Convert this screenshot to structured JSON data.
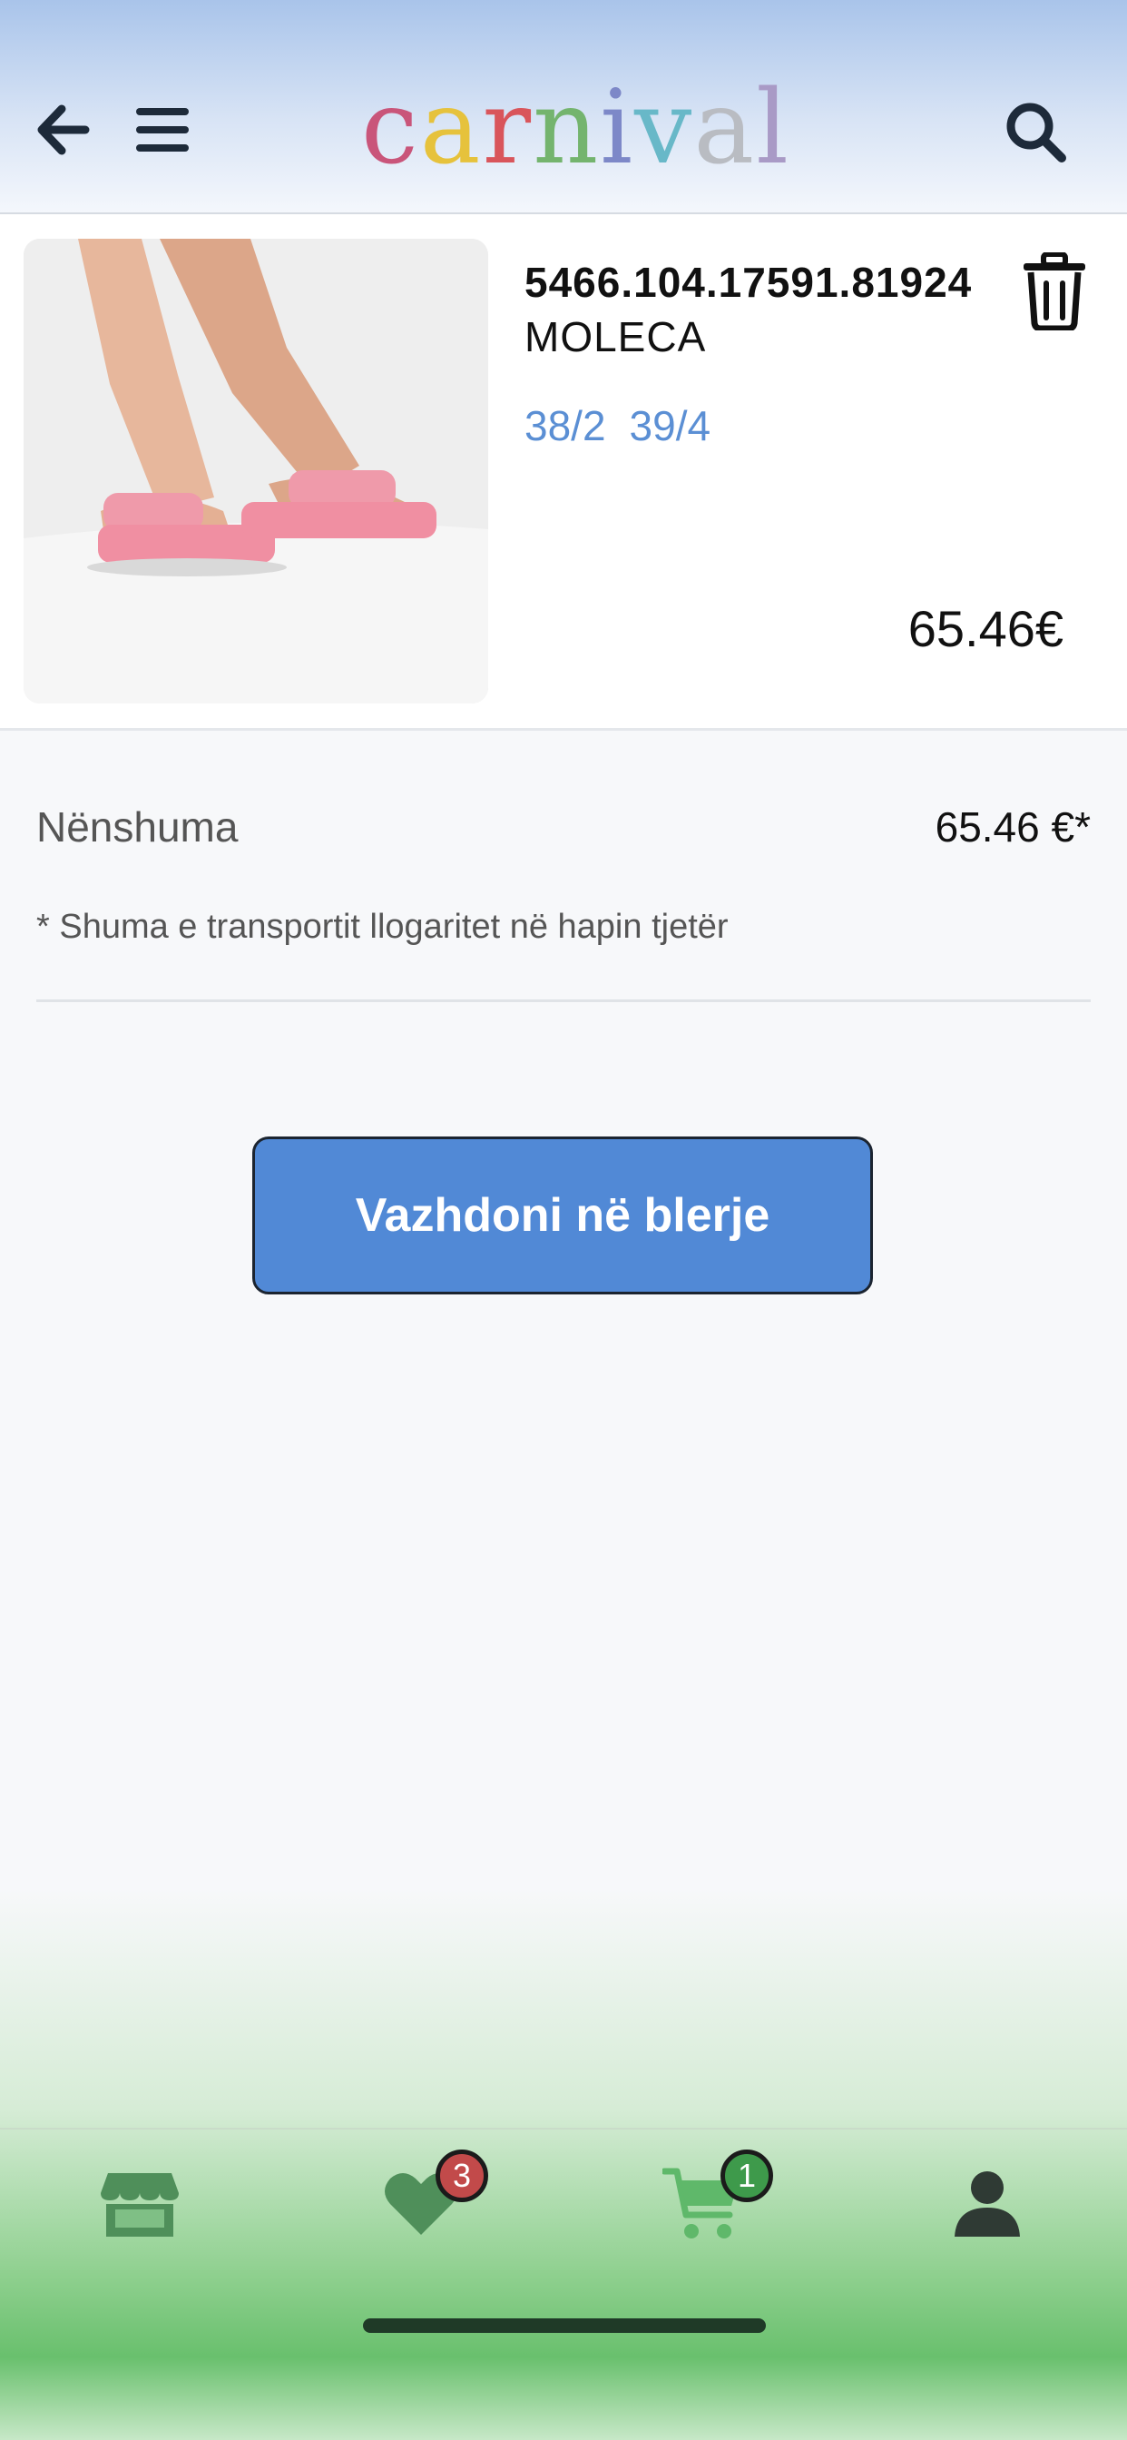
{
  "header": {
    "logo_letters": [
      "c",
      "a",
      "r",
      "n",
      "i",
      "v",
      "a",
      "l"
    ],
    "logo_colors": [
      "#c9557a",
      "#e6c23c",
      "#d9555b",
      "#74b46e",
      "#7d88c8",
      "#68b8c8",
      "#b9bcc2",
      "#a99ac6"
    ]
  },
  "cart": {
    "item": {
      "sku": "5466.104.17591.81924",
      "name": "MOLECA",
      "sizes": [
        "38/2",
        "39/4"
      ],
      "price": "65.46€"
    }
  },
  "summary": {
    "subtotal_label": "Nënshuma",
    "subtotal_value": "65.46 €*",
    "note": "* Shuma e transportit llogaritet në hapin tjetër"
  },
  "cta": {
    "label": "Vazhdoni në blerje"
  },
  "nav": {
    "wishlist_badge": "3",
    "cart_badge": "1"
  },
  "colors": {
    "accent": "#5189d6",
    "nav_icon": "#4f8f5a",
    "wishlist_badge": "#c24a4a",
    "cart_badge": "#3e9a4b"
  }
}
